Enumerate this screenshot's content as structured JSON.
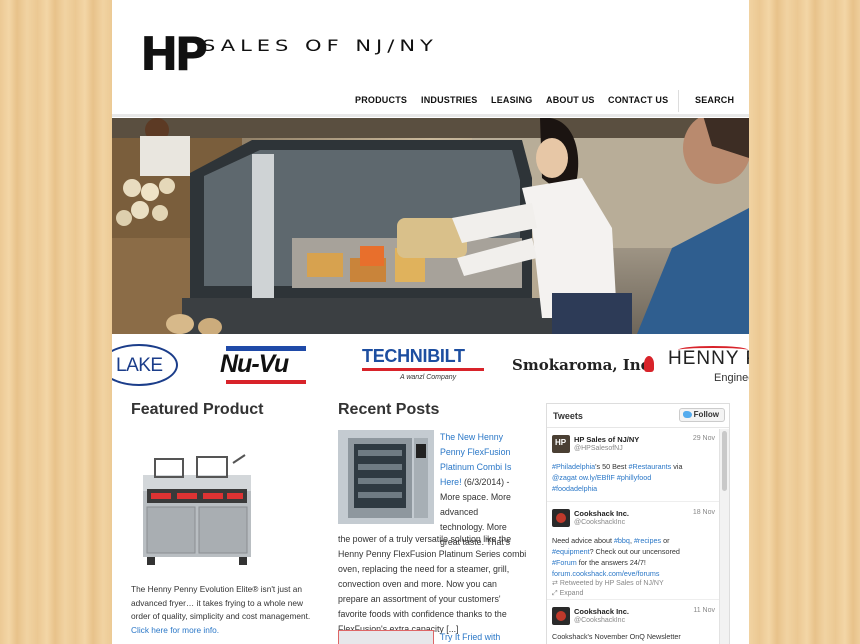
{
  "header": {
    "logo_mark": "HP",
    "logo_text": "SALES OF NJ/NY"
  },
  "nav": {
    "items": [
      "PRODUCTS",
      "INDUSTRIES",
      "LEASING",
      "ABOUT US",
      "CONTACT US"
    ],
    "search": "SEARCH"
  },
  "brands": {
    "lake": "LAKE",
    "nuvu": "Nu-Vu",
    "technibilt": "TECHNIBILT",
    "technibilt_sub": "A wanzl Company",
    "smokaroma": "Smokaroma, Inc.",
    "henny": "HENNY P",
    "henny_sub": "Engineer"
  },
  "featured": {
    "heading": "Featured Product",
    "text": "The Henny Penny Evolution Elite® isn't just an advanced fryer… it takes frying to a whole new order of quality, simplicity and cost management.",
    "link": "Click here for more info."
  },
  "posts": {
    "heading": "Recent Posts",
    "post1_title": "The New Henny Penny FlexFusion Platinum Combi Is Here!",
    "post1_date": " (6/3/2014) -",
    "post1_line_a": "More space. More",
    "post1_line_b": "advanced",
    "post1_line_c": "technology. More",
    "post1_line_d": "great taste. That's",
    "post1_rest": "the power of a truly versatile solution like the Henny Penny FlexFusion Platinum Series combi oven, replacing the need for a steamer, grill, convection oven and more. Now you can prepare an assortment of your customers' favorite foods with confidence thanks to the FlexFusion's extra capacity [...]",
    "post2_title": "Try It Fried with"
  },
  "tweets": {
    "title": "Tweets",
    "follow": "Follow",
    "t1_name": "HP Sales of NJ/NY",
    "t1_handle": "@HPSalesofNJ",
    "t1_date": "29 Nov",
    "t1_body_a": "#Philadelphia",
    "t1_body_b": "'s 50 Best ",
    "t1_body_c": "#Restaurants",
    "t1_body_d": " via",
    "t1_body_e": "@zagat ow.ly/EBfIF #phillyfood",
    "t1_body_f": "#foodadelphia",
    "t2_name": "Cookshack Inc.",
    "t2_handle": "@CookshackInc",
    "t2_date": "18 Nov",
    "t2_body_a": "Need advice about ",
    "t2_body_b": "#bbq",
    "t2_body_c": ", ",
    "t2_body_d": "#recipes",
    "t2_body_e": " or",
    "t2_body_f": "#equipment",
    "t2_body_g": "? Check out our uncensored",
    "t2_body_h": "#Forum",
    "t2_body_i": " for the answers 24/7!",
    "t2_body_j": "forum.cookshack.com/eve/forums",
    "t2_retweet": "Retweeted by HP Sales of NJ/NY",
    "t2_expand": "Expand",
    "t3_name": "Cookshack Inc.",
    "t3_handle": "@CookshackInc",
    "t3_date": "11 Nov",
    "t3_body": "Cookshack's November OnQ Newsletter"
  }
}
